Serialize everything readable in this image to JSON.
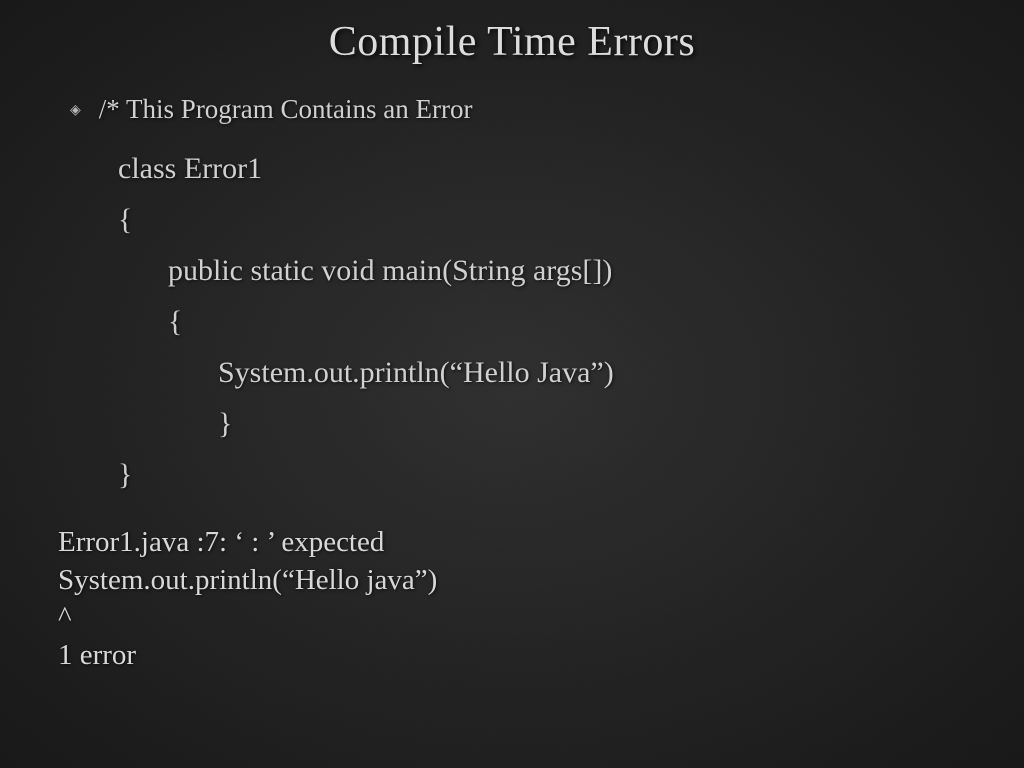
{
  "slide": {
    "title": "Compile Time Errors",
    "bullet": "/* This Program Contains an Error",
    "code": {
      "line1": "class Error1",
      "line2": "{",
      "line3": "public static void main(String args[])",
      "line4": "{",
      "line5": "System.out.println(“Hello Java”)",
      "line6": "}",
      "line7": "}"
    },
    "error": {
      "line1": "Error1.java :7: ‘ : ’ expected",
      "line2": "System.out.println(“Hello java”)",
      "line3": "^",
      "line4": "1 error"
    }
  }
}
